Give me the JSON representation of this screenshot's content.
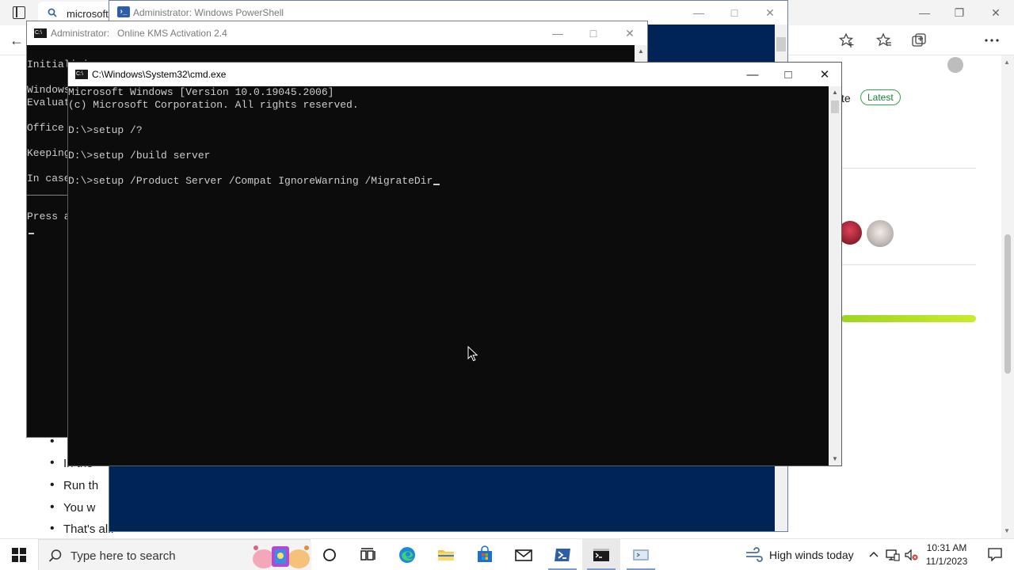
{
  "edge": {
    "tab_text": "microsoft",
    "latest_fragment": "te",
    "latest_badge": "Latest",
    "list_items": [
      "",
      "In the",
      "Run th",
      "You w",
      "That's all."
    ],
    "progress_fraction": 1.0
  },
  "powershell": {
    "title": "Administrator: Windows PowerShell"
  },
  "kms": {
    "title_prefix": "Administrator:",
    "title_name": "Online KMS Activation 2.4",
    "lines": [
      "Initializi",
      "Windows",
      "Evaluati",
      "Office",
      "Keeping",
      "In case",
      "_______",
      "Press a"
    ]
  },
  "cmd": {
    "title": "C:\\Windows\\System32\\cmd.exe",
    "lines": [
      "Microsoft Windows [Version 10.0.19045.2006]",
      "(c) Microsoft Corporation. All rights reserved.",
      "",
      "D:\\>setup /?",
      "",
      "D:\\>setup /build server",
      "",
      "D:\\>setup /Product Server /Compat IgnoreWarning /MigrateDir"
    ]
  },
  "taskbar": {
    "search_placeholder": "Type here to search",
    "weather_text": "High winds today",
    "time": "10:31 AM",
    "date": "11/1/2023"
  },
  "colors": {
    "powershell_bg": "#012456",
    "console_bg": "#0c0c0c",
    "console_text": "#cccccc",
    "latest_badge": "#2ba84a",
    "progress": "#b4e02a"
  }
}
